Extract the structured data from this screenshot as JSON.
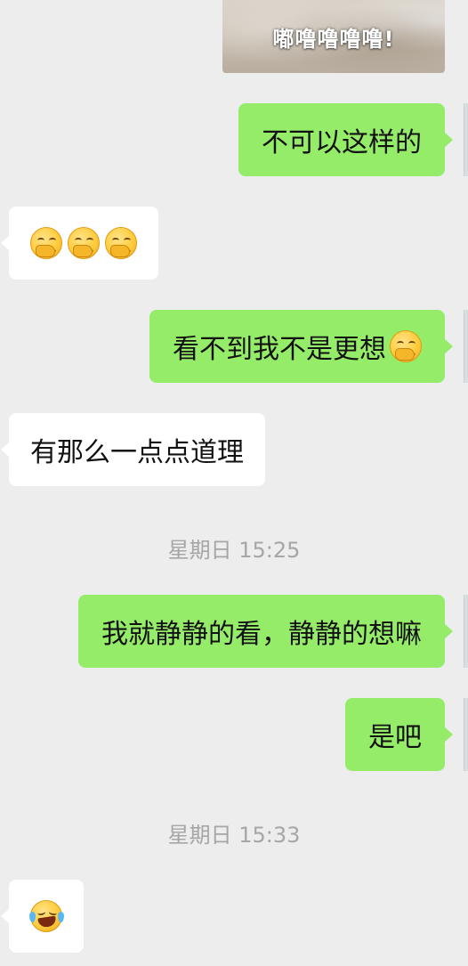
{
  "image_message": {
    "caption": "嘟噜噜噜噜!"
  },
  "messages": [
    {
      "id": "m1",
      "side": "out",
      "text": "不可以这样的"
    },
    {
      "id": "m2",
      "side": "in",
      "emojis": [
        "cover-mouth-smile",
        "cover-mouth-smile",
        "cover-mouth-smile"
      ]
    },
    {
      "id": "m3",
      "side": "out",
      "text": "看不到我不是更想",
      "emojis": [
        "cover-mouth-smile"
      ]
    },
    {
      "id": "m4",
      "side": "in",
      "text": "有那么一点点道理"
    },
    {
      "id": "m5",
      "side": "out",
      "text": "我就静静的看，静静的想嘛"
    },
    {
      "id": "m6",
      "side": "out",
      "text": "是吧"
    },
    {
      "id": "m7",
      "side": "in",
      "emojis": [
        "rolling-on-floor-laughing"
      ]
    }
  ],
  "timestamps": {
    "t1": "星期日 15:25",
    "t2": "星期日 15:33"
  },
  "colors": {
    "background": "#ededed",
    "outgoing_bubble": "#95ec69",
    "incoming_bubble": "#ffffff",
    "timestamp_text": "#a6a6a6"
  }
}
